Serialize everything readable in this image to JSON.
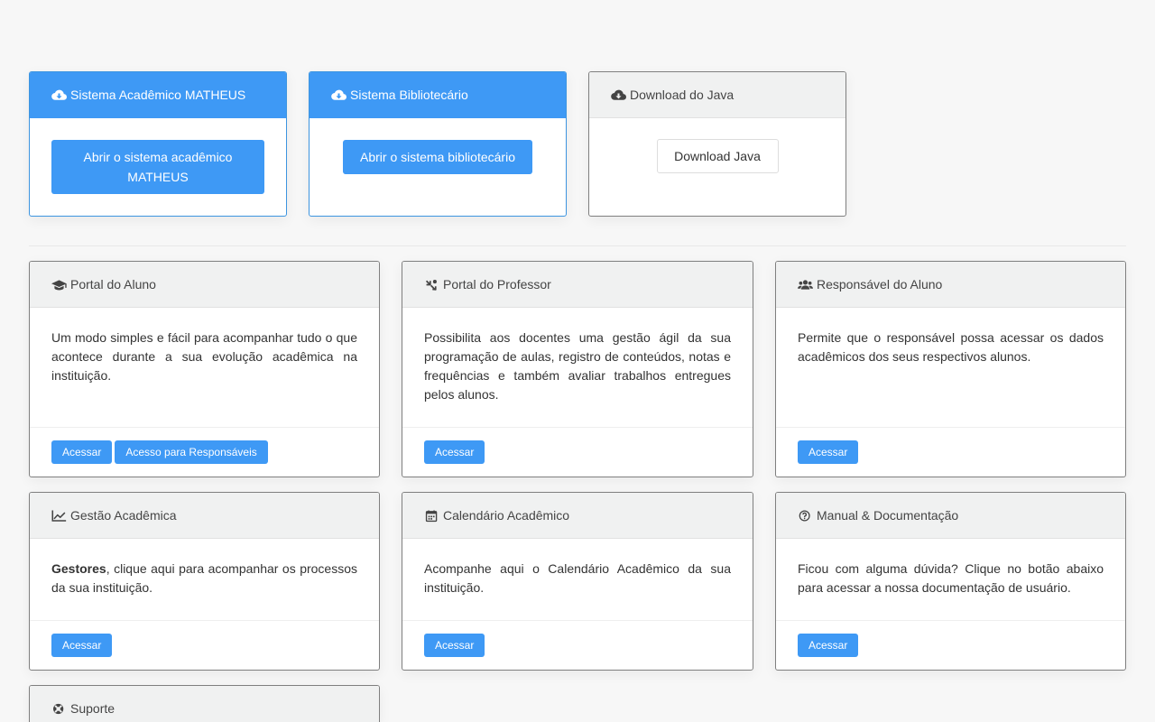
{
  "top_cards": [
    {
      "title": "Sistema Acadêmico MATHEUS",
      "icon": "cloud-download-icon",
      "button": "Abrir o sistema acadêmico MATHEUS"
    },
    {
      "title": "Sistema Bibliotecário",
      "icon": "cloud-download-icon",
      "button": "Abrir o sistema bibliotecário"
    },
    {
      "title": "Download do Java",
      "icon": "cloud-download-icon",
      "button": "Download Java"
    }
  ],
  "portal_cards": [
    {
      "title": "Portal do Aluno",
      "icon": "graduation-cap-icon",
      "text": "Um modo simples e fácil para acompanhar tudo o que acontece durante a sua evolução acadêmica na instituição.",
      "buttons": [
        "Acessar",
        "Acesso para Responsáveis"
      ]
    },
    {
      "title": "Portal do Professor",
      "icon": "chalkboard-teacher-icon",
      "text": "Possibilita aos docentes uma gestão ágil da sua programação de aulas, registro de conteúdos, notas e frequências e também avaliar trabalhos entregues pelos alunos.",
      "buttons": [
        "Acessar"
      ]
    },
    {
      "title": "Responsável do Aluno",
      "icon": "users-icon",
      "text": "Permite que o responsável possa acessar os dados acadêmicos dos seus respectivos alunos.",
      "buttons": [
        "Acessar"
      ]
    },
    {
      "title": "Gestão Acadêmica",
      "icon": "line-chart-icon",
      "text_bold": "Gestores",
      "text": ", clique aqui para acompanhar os processos da sua instituição.",
      "buttons": [
        "Acessar"
      ]
    },
    {
      "title": "Calendário Acadêmico",
      "icon": "calendar-icon",
      "text": "Acompanhe aqui o Calendário Acadêmico da sua instituição.",
      "buttons": [
        "Acessar"
      ]
    },
    {
      "title": "Manual & Documentação",
      "icon": "question-circle-icon",
      "text": "Ficou com alguma dúvida? Clique no botão abaixo para acessar a nossa documentação de usuário.",
      "buttons": [
        "Acessar"
      ]
    },
    {
      "title": "Suporte",
      "icon": "life-ring-icon"
    }
  ],
  "colors": {
    "primary": "#3e99f5",
    "background": "#f7f7f7",
    "header_gray": "#f0f1f1"
  }
}
